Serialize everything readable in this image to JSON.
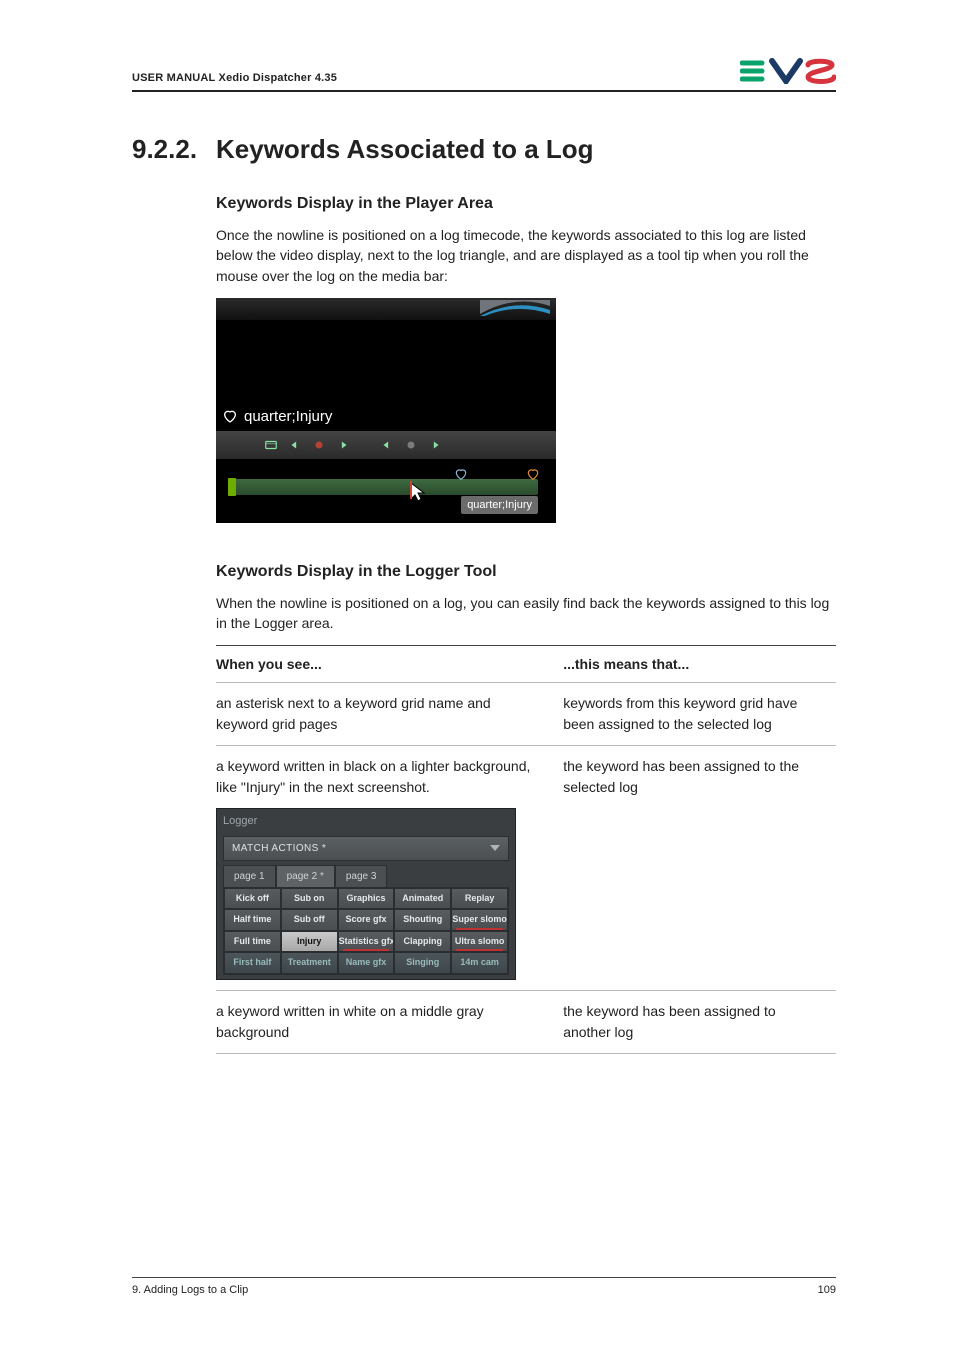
{
  "header": {
    "left": "USER MANUAL Xedio Dispatcher 4.35"
  },
  "section": {
    "num": "9.2.2.",
    "title": "Keywords Associated to a Log"
  },
  "sub1": {
    "title": "Keywords Display in the Player Area",
    "para": "Once the nowline is positioned on a log timecode, the keywords associated to this log are listed below the video display, next to the log triangle, and are displayed as a tool tip when you roll the mouse over the log on the media bar:"
  },
  "player": {
    "keywords_text": "quarter;Injury",
    "tooltip": "quarter;Injury"
  },
  "sub2": {
    "title": "Keywords Display in the Logger Tool",
    "para": "When the nowline is positioned on a log, you can easily find back the keywords assigned to this log in the Logger area."
  },
  "table": {
    "head_left": "When you see...",
    "head_right": "...this means that...",
    "rows": [
      {
        "left": "an asterisk next to a keyword grid name and keyword grid pages",
        "right": "keywords from this keyword grid have been assigned to the selected log"
      },
      {
        "left_intro": "a keyword written in black on a lighter background, like \"Injury\" in the next screenshot.",
        "right": "the keyword has been assigned to the selected log"
      },
      {
        "left": "a keyword written in white on a middle gray background",
        "right": "the keyword has been assigned to another log"
      }
    ]
  },
  "logger": {
    "title": "Logger",
    "dropdown": "MATCH ACTIONS *",
    "tabs": [
      "page 1",
      "page 2 *",
      "page 3"
    ],
    "grid": [
      [
        "Kick off",
        "Sub on",
        "Graphics",
        "Animated",
        "Replay"
      ],
      [
        "Half time",
        "Sub off",
        "Score gfx",
        "Shouting",
        "Super slomo"
      ],
      [
        "Full time",
        "Injury",
        "Statistics gfx",
        "Clapping",
        "Ultra slomo"
      ],
      [
        "First half",
        "Treatment",
        "Name gfx",
        "Singing",
        "14m cam"
      ]
    ]
  },
  "footer": {
    "left": "9. Adding Logs to a Clip",
    "right": "109"
  }
}
